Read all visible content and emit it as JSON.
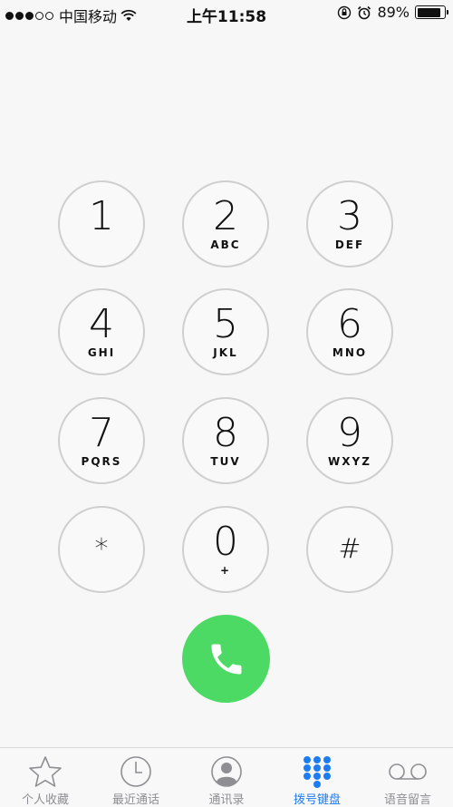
{
  "status_bar": {
    "carrier": "中国移动",
    "time": "上午11:58",
    "battery": "89%",
    "battery_level": 0.89
  },
  "keypad": {
    "keys": [
      {
        "digit": "1",
        "letters": ""
      },
      {
        "digit": "2",
        "letters": "ABC"
      },
      {
        "digit": "3",
        "letters": "DEF"
      },
      {
        "digit": "4",
        "letters": "GHI"
      },
      {
        "digit": "5",
        "letters": "JKL"
      },
      {
        "digit": "6",
        "letters": "MNO"
      },
      {
        "digit": "7",
        "letters": "PQRS"
      },
      {
        "digit": "8",
        "letters": "TUV"
      },
      {
        "digit": "9",
        "letters": "WXYZ"
      },
      {
        "digit": "*",
        "letters": ""
      },
      {
        "digit": "0",
        "letters": "+"
      },
      {
        "digit": "#",
        "letters": ""
      }
    ]
  },
  "tab_bar": {
    "tabs": [
      {
        "label": "个人收藏",
        "icon": "star-icon"
      },
      {
        "label": "最近通话",
        "icon": "clock-icon"
      },
      {
        "label": "通讯录",
        "icon": "contact-icon"
      },
      {
        "label": "拨号键盘",
        "icon": "keypad-icon",
        "active": true
      },
      {
        "label": "语音留言",
        "icon": "voicemail-icon"
      }
    ]
  },
  "colors": {
    "call_green": "#4cd964",
    "active_blue": "#1e7cf2",
    "inactive_gray": "#8e8e93",
    "key_border": "#cfcfcf"
  }
}
